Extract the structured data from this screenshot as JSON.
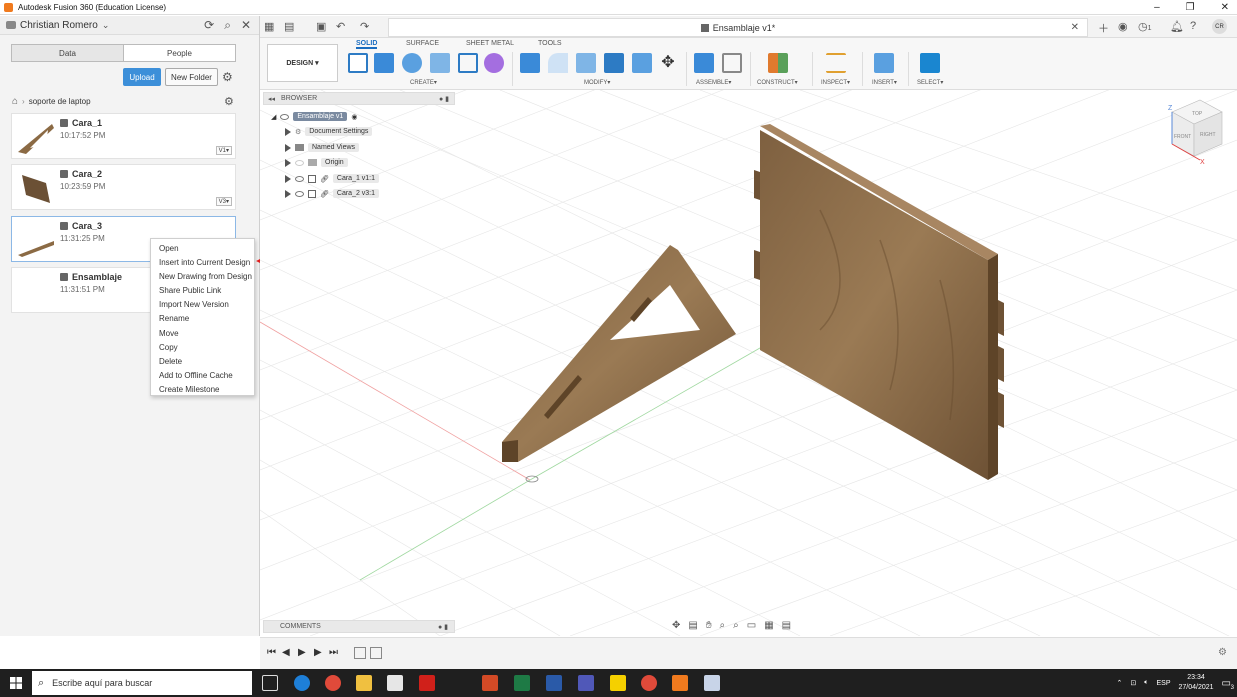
{
  "window": {
    "title": "Autodesk Fusion 360 (Education License)"
  },
  "data_panel": {
    "user": "Christian Romero",
    "tabs": [
      "Data",
      "People"
    ],
    "upload_label": "Upload",
    "new_folder_label": "New Folder",
    "breadcrumb": "soporte de laptop",
    "items": [
      {
        "name": "Cara_1",
        "time": "10:17:52 PM",
        "version": "V1"
      },
      {
        "name": "Cara_2",
        "time": "10:23:59 PM",
        "version": "V3"
      },
      {
        "name": "Cara_3",
        "time": "11:31:25 PM",
        "version": ""
      },
      {
        "name": "Ensamblaje",
        "time": "11:31:51 PM",
        "version": ""
      }
    ]
  },
  "context_menu": {
    "items": [
      "Open",
      "Insert into Current Design",
      "New Drawing from Design",
      "Share Public Link",
      "Import New Version",
      "Rename",
      "Move",
      "Copy",
      "Delete",
      "Add to Offline Cache",
      "Create Milestone"
    ]
  },
  "document_tab": {
    "title": "Ensamblaje v1*"
  },
  "toolbar": {
    "workspace": "DESIGN",
    "tabs": [
      "SOLID",
      "SURFACE",
      "SHEET METAL",
      "TOOLS"
    ],
    "groups": [
      "CREATE",
      "MODIFY",
      "ASSEMBLE",
      "CONSTRUCT",
      "INSPECT",
      "INSERT",
      "SELECT"
    ]
  },
  "browser": {
    "header": "BROWSER",
    "root": "Ensamblaje v1",
    "nodes": [
      "Document Settings",
      "Named Views",
      "Origin",
      "Cara_1 v1:1",
      "Cara_2 v3:1"
    ]
  },
  "comments_label": "COMMENTS",
  "viewcube": {
    "axis_z": "Z",
    "axis_x": "X",
    "face_front": "FRONT",
    "face_right": "RIGHT",
    "face_top": "TOP"
  },
  "topbar": {
    "notifications": "1",
    "avatar": "CR"
  },
  "taskbar": {
    "search_placeholder": "Escribe aquí para buscar",
    "language": "ESP",
    "time": "23:34",
    "date": "27/04/2021",
    "notif_count": "3"
  },
  "colors": {
    "accent": "#3c8fd9",
    "wood": "#8b6a44",
    "taskbar": "#1f1f1f",
    "arrow": "#e02020"
  }
}
